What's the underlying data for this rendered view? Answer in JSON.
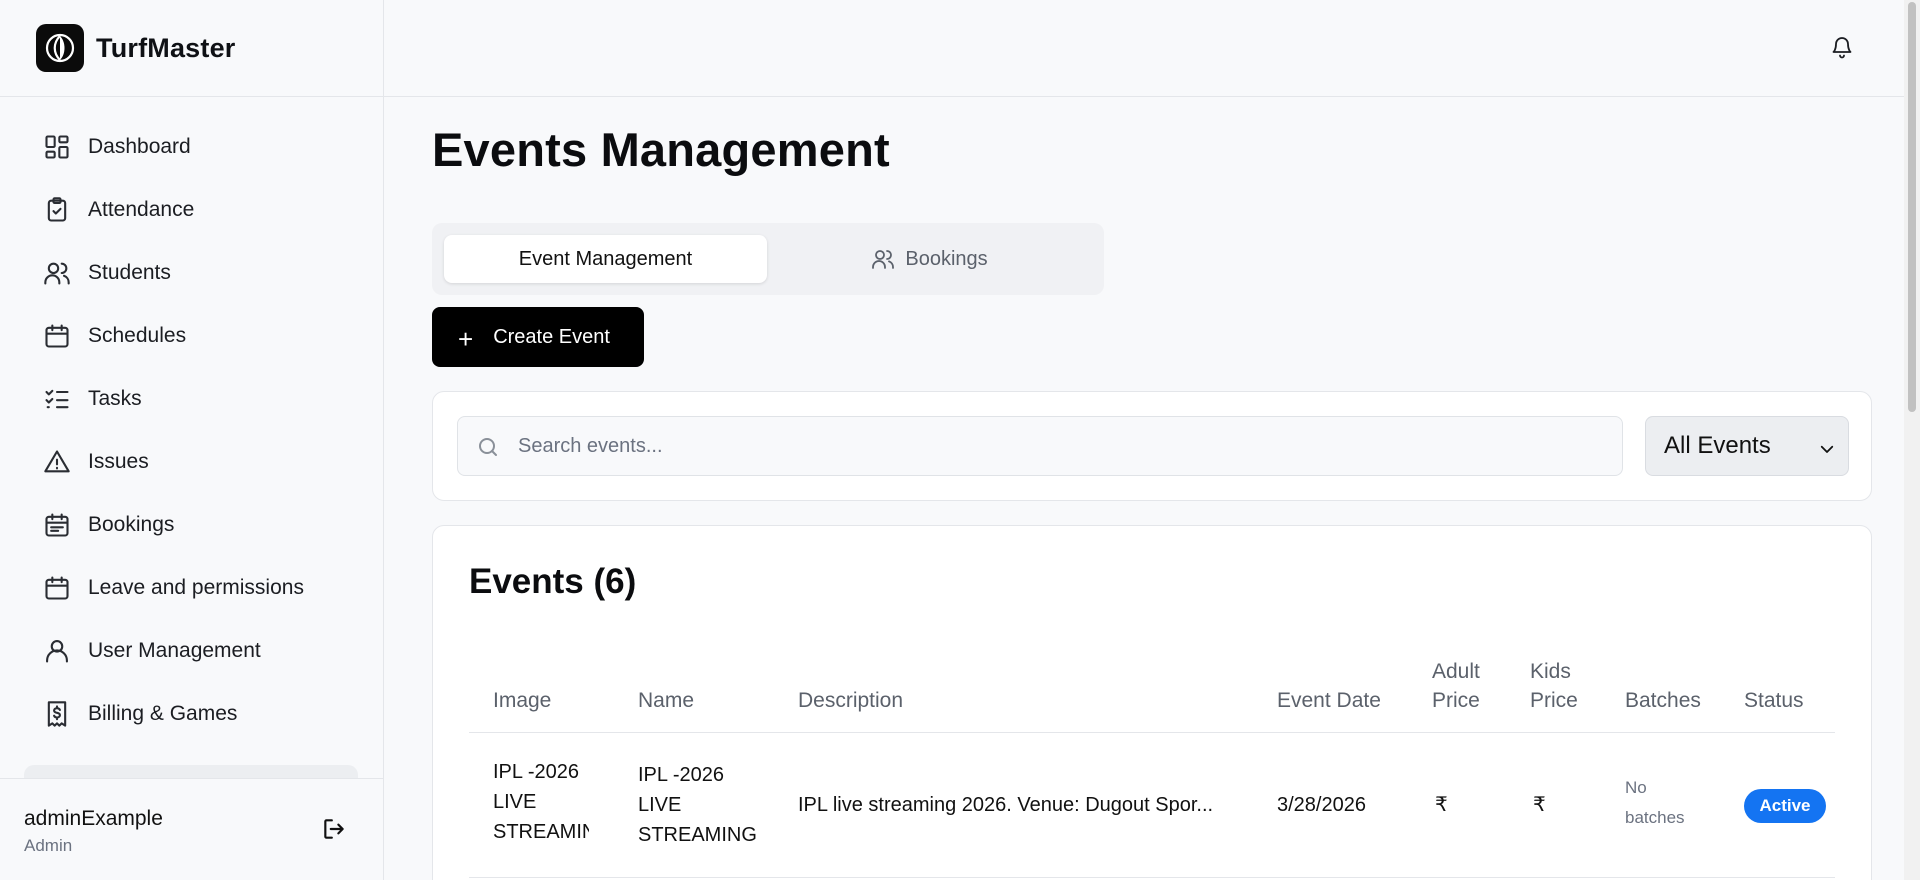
{
  "app": {
    "name": "TurfMaster"
  },
  "sidebar": {
    "items": [
      {
        "label": "Dashboard",
        "icon": "dashboard-icon"
      },
      {
        "label": "Attendance",
        "icon": "clipboard-check-icon"
      },
      {
        "label": "Students",
        "icon": "users-icon"
      },
      {
        "label": "Schedules",
        "icon": "calendar-icon"
      },
      {
        "label": "Tasks",
        "icon": "list-checks-icon"
      },
      {
        "label": "Issues",
        "icon": "alert-triangle-icon"
      },
      {
        "label": "Bookings",
        "icon": "calendar-lines-icon"
      },
      {
        "label": "Leave and permissions",
        "icon": "calendar-icon"
      },
      {
        "label": "User Management",
        "icon": "user-icon"
      },
      {
        "label": "Billing & Games",
        "icon": "receipt-icon"
      }
    ]
  },
  "user": {
    "name": "adminExample",
    "role": "Admin"
  },
  "page": {
    "title": "Events Management"
  },
  "tabs": {
    "event_management": "Event Management",
    "bookings": "Bookings"
  },
  "actions": {
    "create_event": "Create Event"
  },
  "filters": {
    "search_placeholder": "Search events...",
    "select_value": "All Events"
  },
  "events": {
    "title": "Events (6)",
    "columns": {
      "image": "Image",
      "name": "Name",
      "description": "Description",
      "event_date": "Event Date",
      "adult_price_1": "Adult",
      "adult_price_2": "Price",
      "kids_price_1": "Kids",
      "kids_price_2": "Price",
      "batches": "Batches",
      "status": "Status"
    },
    "rows": [
      {
        "image_alt_1": "IPL -2026",
        "image_alt_2": "LIVE",
        "image_alt_3": "STREAMIN",
        "name_1": "IPL -2026",
        "name_2": "LIVE",
        "name_3": "STREAMING",
        "description": "IPL live streaming 2026. Venue: Dugout Spor...",
        "event_date": "3/28/2026",
        "adult_price": "₹",
        "kids_price": "₹",
        "batches_1": "No",
        "batches_2": "batches",
        "status": "Active"
      }
    ]
  },
  "colors": {
    "accent": "#1474f2",
    "primary_button": "#000000"
  }
}
